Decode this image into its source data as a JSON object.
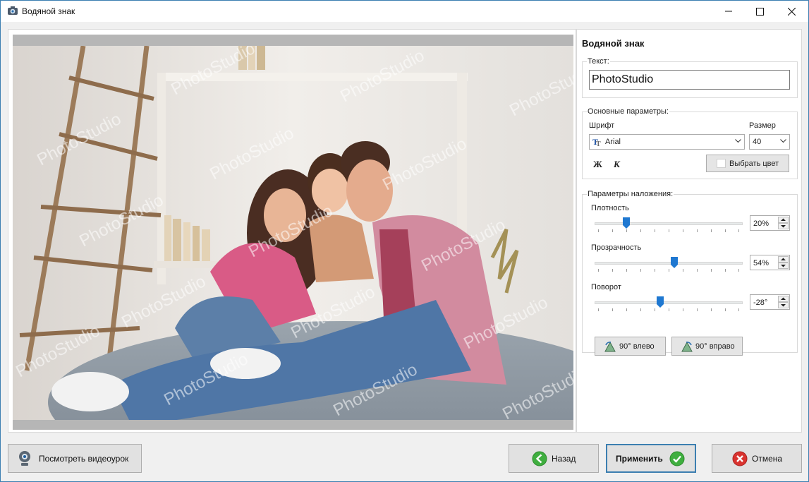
{
  "window": {
    "title": "Водяной знак"
  },
  "panel": {
    "title": "Водяной знак",
    "text_group": {
      "label": "Текст:",
      "value": "PhotoStudio"
    },
    "main_group": {
      "label": "Основные параметры:",
      "font_label": "Шрифт",
      "font_value": "Arial",
      "size_label": "Размер",
      "size_value": "40",
      "bold_label": "Ж",
      "italic_label": "К",
      "color_button": "Выбрать цвет",
      "color_value": "#ffffff"
    },
    "overlay_group": {
      "label": "Параметры наложения:",
      "density": {
        "label": "Плотность",
        "value": "20%",
        "level": 0.2
      },
      "opacity": {
        "label": "Прозрачность",
        "value": "54%",
        "level": 0.54
      },
      "rotation": {
        "label": "Поворот",
        "value": "-28°",
        "level": 0.44
      },
      "rotate_left": "90° влево",
      "rotate_right": "90° вправо"
    }
  },
  "preview": {
    "watermark_text": "PhotoStudio"
  },
  "footer": {
    "video_button": "Посмотреть видеоурок",
    "back_button": "Назад",
    "apply_button": "Применить",
    "cancel_button": "Отмена"
  },
  "colors": {
    "accent": "#3c7fb1",
    "apply_check": "#3fae3f",
    "back_arrow": "#3fae3f",
    "cancel_x": "#d9332f",
    "slider_thumb": "#1f78d1"
  }
}
